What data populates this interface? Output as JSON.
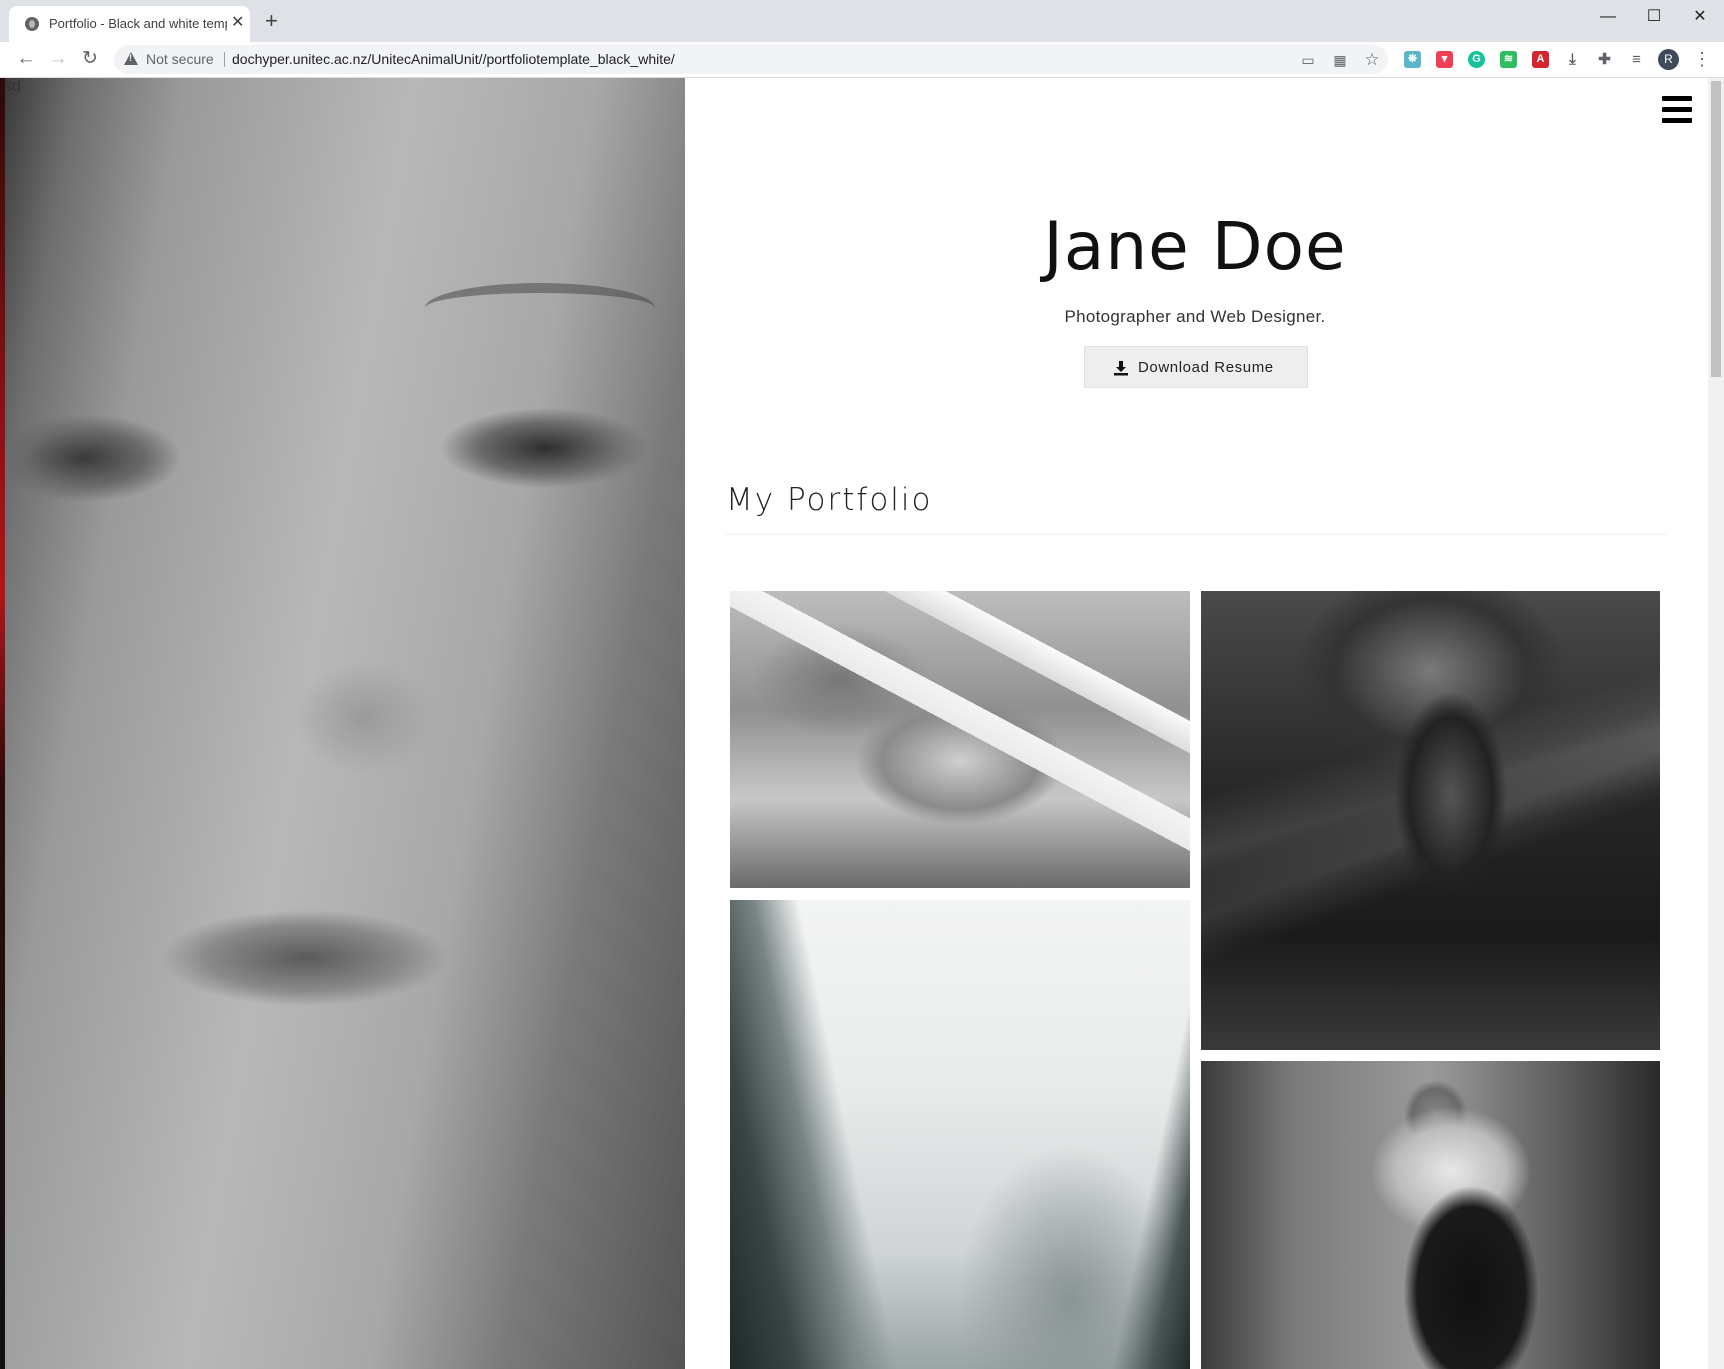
{
  "browser": {
    "tab_title": "Portfolio - Black and white templ",
    "tab_close": "✕",
    "new_tab": "+",
    "security_label": "Not secure",
    "url": "dochyper.unitec.ac.nz/UnitecAnimalUnit//portfoliotemplate_black_white/",
    "profile_initial": "R",
    "window_controls": {
      "minimize": "—",
      "maximize": "☐",
      "close": "✕"
    },
    "nav": {
      "back": "←",
      "forward": "→",
      "reload": "↻"
    },
    "icons": [
      "cast-icon",
      "apps-icon",
      "star-icon",
      "extension-icon",
      "pocket-icon",
      "grammarly-icon",
      "evernote-icon",
      "acrobat-icon",
      "download-icon",
      "puzzle-icon",
      "reading-list-icon"
    ]
  },
  "page": {
    "stray_text": "sd",
    "name": "Jane Doe",
    "tagline": "Photographer and Web Designer.",
    "resume_button": "Download Resume",
    "portfolio_title": "My Portfolio",
    "gallery": [
      {
        "name": "wedding-car-photo"
      },
      {
        "name": "underwater-swimmer-photo"
      },
      {
        "name": "misty-canyon-photo"
      },
      {
        "name": "chef-kitchen-photo"
      }
    ]
  },
  "colors": {
    "accent": "#000000",
    "button_bg": "#eeeeee",
    "tabbar_bg": "#dee1e6"
  }
}
